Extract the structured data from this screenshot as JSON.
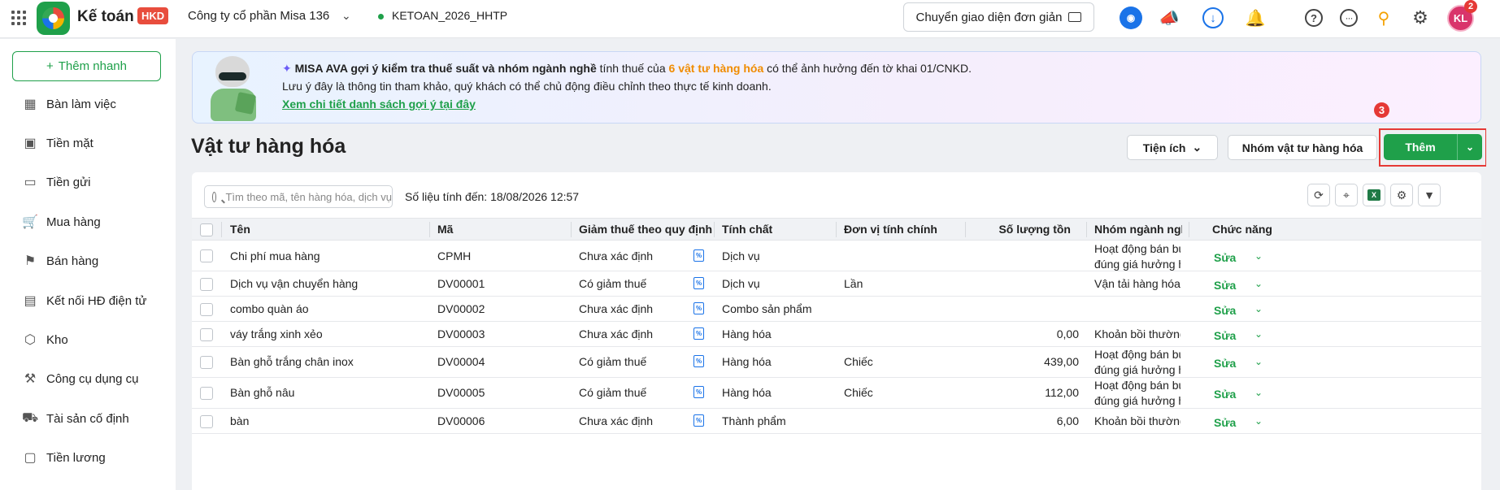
{
  "header": {
    "app_name": "Kế toán",
    "app_badge": "HKD",
    "company": "Công ty cổ phần Misa 136",
    "database": "KETOAN_2026_HHTP",
    "switch_ui_label": "Chuyển giao diện đơn giản",
    "avatar_initials": "KL",
    "notification_count": "2",
    "icons": [
      "grid-icon",
      "robot-icon",
      "megaphone-icon",
      "download-icon",
      "bell-icon",
      "help-icon",
      "more-icon",
      "badge-icon",
      "gear-icon"
    ]
  },
  "sidebar": {
    "quick_add": "Thêm nhanh",
    "items": [
      {
        "label": "Bàn làm việc",
        "icon": "dashboard-icon"
      },
      {
        "label": "Tiền mặt",
        "icon": "wallet-icon"
      },
      {
        "label": "Tiền gửi",
        "icon": "card-icon"
      },
      {
        "label": "Mua hàng",
        "icon": "cart-icon"
      },
      {
        "label": "Bán hàng",
        "icon": "tag-icon"
      },
      {
        "label": "Kết nối HĐ điện tử",
        "icon": "invoice-icon"
      },
      {
        "label": "Kho",
        "icon": "box-icon"
      },
      {
        "label": "Công cụ dụng cụ",
        "icon": "tool-icon"
      },
      {
        "label": "Tài sản cố định",
        "icon": "asset-icon"
      },
      {
        "label": "Tiền lương",
        "icon": "salary-icon"
      }
    ]
  },
  "banner": {
    "prefix": "MISA AVA gợi ý kiểm tra thuế suất và nhóm ngành nghề",
    "mid": " tính thuế của ",
    "highlight": "6 vật tư hàng hóa",
    "suffix": " có thể ảnh hưởng đến tờ khai 01/CNKD.",
    "line2": "Lưu ý đây là thông tin tham khảo, quý khách có thể chủ động điều chỉnh theo thực tế kinh doanh.",
    "link": "Xem chi tiết danh sách gợi ý tại đây",
    "step_number": "3"
  },
  "page": {
    "title": "Vật tư hàng hóa",
    "utilities_label": "Tiện ích",
    "group_label": "Nhóm vật tư hàng hóa",
    "add_label": "Thêm"
  },
  "toolbar": {
    "search_placeholder": "Tìm theo mã, tên hàng hóa, dịch vụ",
    "data_as_of": "Số liệu tính đến: 18/08/2026 12:57"
  },
  "table": {
    "columns": [
      "Tên",
      "Mã",
      "Giảm thuế theo quy định",
      "Tính chất",
      "Đơn vị tính chính",
      "Số lượng tồn",
      "Nhóm ngành nghề",
      "Chức năng"
    ],
    "edit_label": "Sửa",
    "rows": [
      {
        "name": "Chi phí mua hàng",
        "code": "CPMH",
        "tax": "Chưa xác định",
        "nature": "Dịch vụ",
        "unit": "",
        "qty": "",
        "group1": "Hoạt động bán buôn",
        "group2": "đúng giá hưởng hoa"
      },
      {
        "name": "Dịch vụ vận chuyển hàng",
        "code": "DV00001",
        "tax": "Có giảm thuế",
        "nature": "Dịch vụ",
        "unit": "Lần",
        "qty": "",
        "group1": "Vận tải hàng hóa, vận",
        "group2": ""
      },
      {
        "name": "combo quàn áo",
        "code": "DV00002",
        "tax": "Chưa xác định",
        "nature": "Combo sản phẩm",
        "unit": "",
        "qty": "",
        "group1": "",
        "group2": ""
      },
      {
        "name": "váy trắng xinh xẻo",
        "code": "DV00003",
        "tax": "Chưa xác định",
        "nature": "Hàng hóa",
        "unit": "",
        "qty": "0,00",
        "group1": "Khoản bồi thường",
        "group2": ""
      },
      {
        "name": "Bàn ghỗ trắng chân inox",
        "code": "DV00004",
        "tax": "Có giảm thuế",
        "nature": "Hàng hóa",
        "unit": "Chiếc",
        "qty": "439,00",
        "group1": "Hoạt động bán buôn",
        "group2": "đúng giá hưởng hoa"
      },
      {
        "name": "Bàn ghỗ nâu",
        "code": "DV00005",
        "tax": "Có giảm thuế",
        "nature": "Hàng hóa",
        "unit": "Chiếc",
        "qty": "112,00",
        "group1": "Hoạt động bán buôn",
        "group2": "đúng giá hưởng hoa"
      },
      {
        "name": "bàn",
        "code": "DV00006",
        "tax": "Chưa xác định",
        "nature": "Thành phẩm",
        "unit": "",
        "qty": "6,00",
        "group1": "Khoản bồi thường",
        "group2": ""
      }
    ]
  }
}
